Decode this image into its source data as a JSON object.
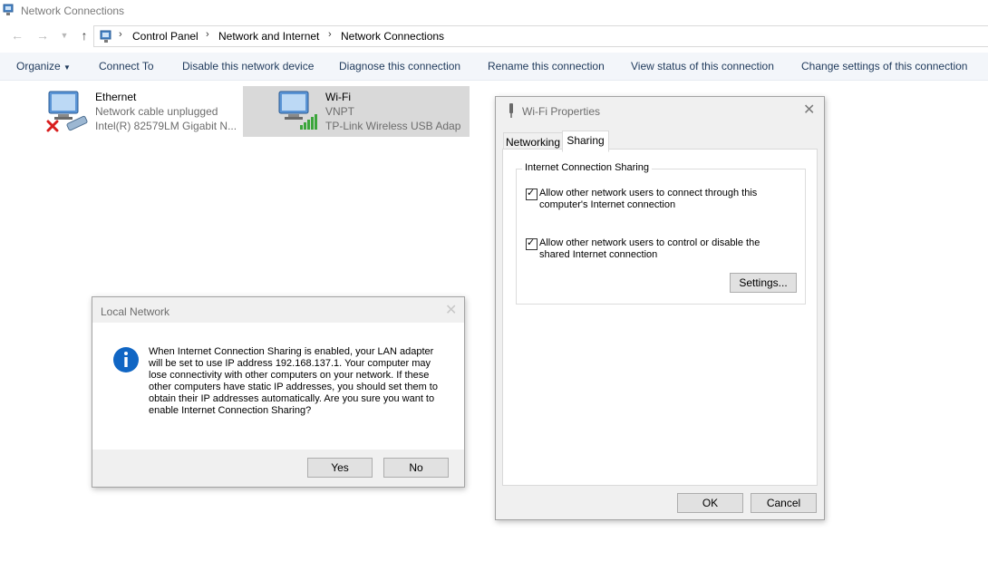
{
  "window": {
    "title": "Network Connections"
  },
  "address": {
    "crumbs": [
      "Control Panel",
      "Network and Internet",
      "Network Connections"
    ]
  },
  "commands": [
    "Organize",
    "Connect To",
    "Disable this network device",
    "Diagnose this connection",
    "Rename this connection",
    "View status of this connection",
    "Change settings of this connection"
  ],
  "connections": [
    {
      "name": "Ethernet",
      "status": "Network cable unplugged",
      "device": "Intel(R) 82579LM Gigabit N..."
    },
    {
      "name": "Wi-Fi",
      "status": "VNPT",
      "device": "TP-Link Wireless USB Adap"
    }
  ],
  "local_dialog": {
    "title": "Local Network",
    "message": "When Internet Connection Sharing is enabled, your LAN adapter will be set to use IP address 192.168.137.1. Your computer may lose connectivity with other computers on your network. If these other computers have static IP addresses, you should set them to obtain their IP addresses automatically.  Are you sure you want to enable Internet Connection Sharing?",
    "yes": "Yes",
    "no": "No"
  },
  "wifi_dialog": {
    "title": "Wi-Fi Properties",
    "tabs": [
      "Networking",
      "Sharing"
    ],
    "group_label": "Internet Connection Sharing",
    "check1": "Allow other network users to connect through this computer's Internet connection",
    "check2": "Allow other network users to control or disable the shared Internet connection",
    "settings": "Settings...",
    "ok": "OK",
    "cancel": "Cancel"
  },
  "colors": {
    "accent": "#1e395b",
    "info_icon": "#1066c4",
    "selected_item": "#d9d9d9",
    "signal_bars": "#3ca63c"
  }
}
